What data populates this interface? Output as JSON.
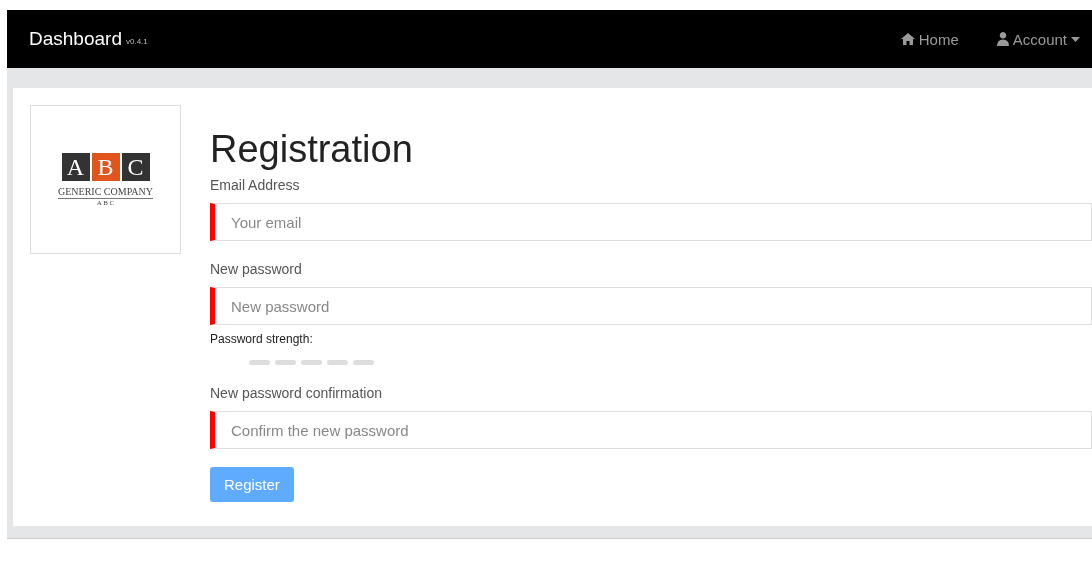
{
  "navbar": {
    "brand": "Dashboard",
    "version": "v0.4.1",
    "links": [
      {
        "kind": "home",
        "label": "Home",
        "dropdown": false
      },
      {
        "kind": "user",
        "label": "Account",
        "dropdown": true
      }
    ]
  },
  "logo": {
    "letters": [
      "A",
      "B",
      "C"
    ],
    "company": "GENERIC COMPANY",
    "tagline": "A B C"
  },
  "form": {
    "title": "Registration",
    "fields": [
      {
        "label": "Email Address",
        "placeholder": "Your email",
        "invalid": true
      },
      {
        "label": "New password",
        "placeholder": "New password",
        "invalid": true
      },
      {
        "label": "New password confirmation",
        "placeholder": "Confirm the new password",
        "invalid": true
      }
    ],
    "strength": {
      "label": "Password strength:"
    },
    "submit": {
      "label": "Register",
      "disabled": true
    }
  }
}
